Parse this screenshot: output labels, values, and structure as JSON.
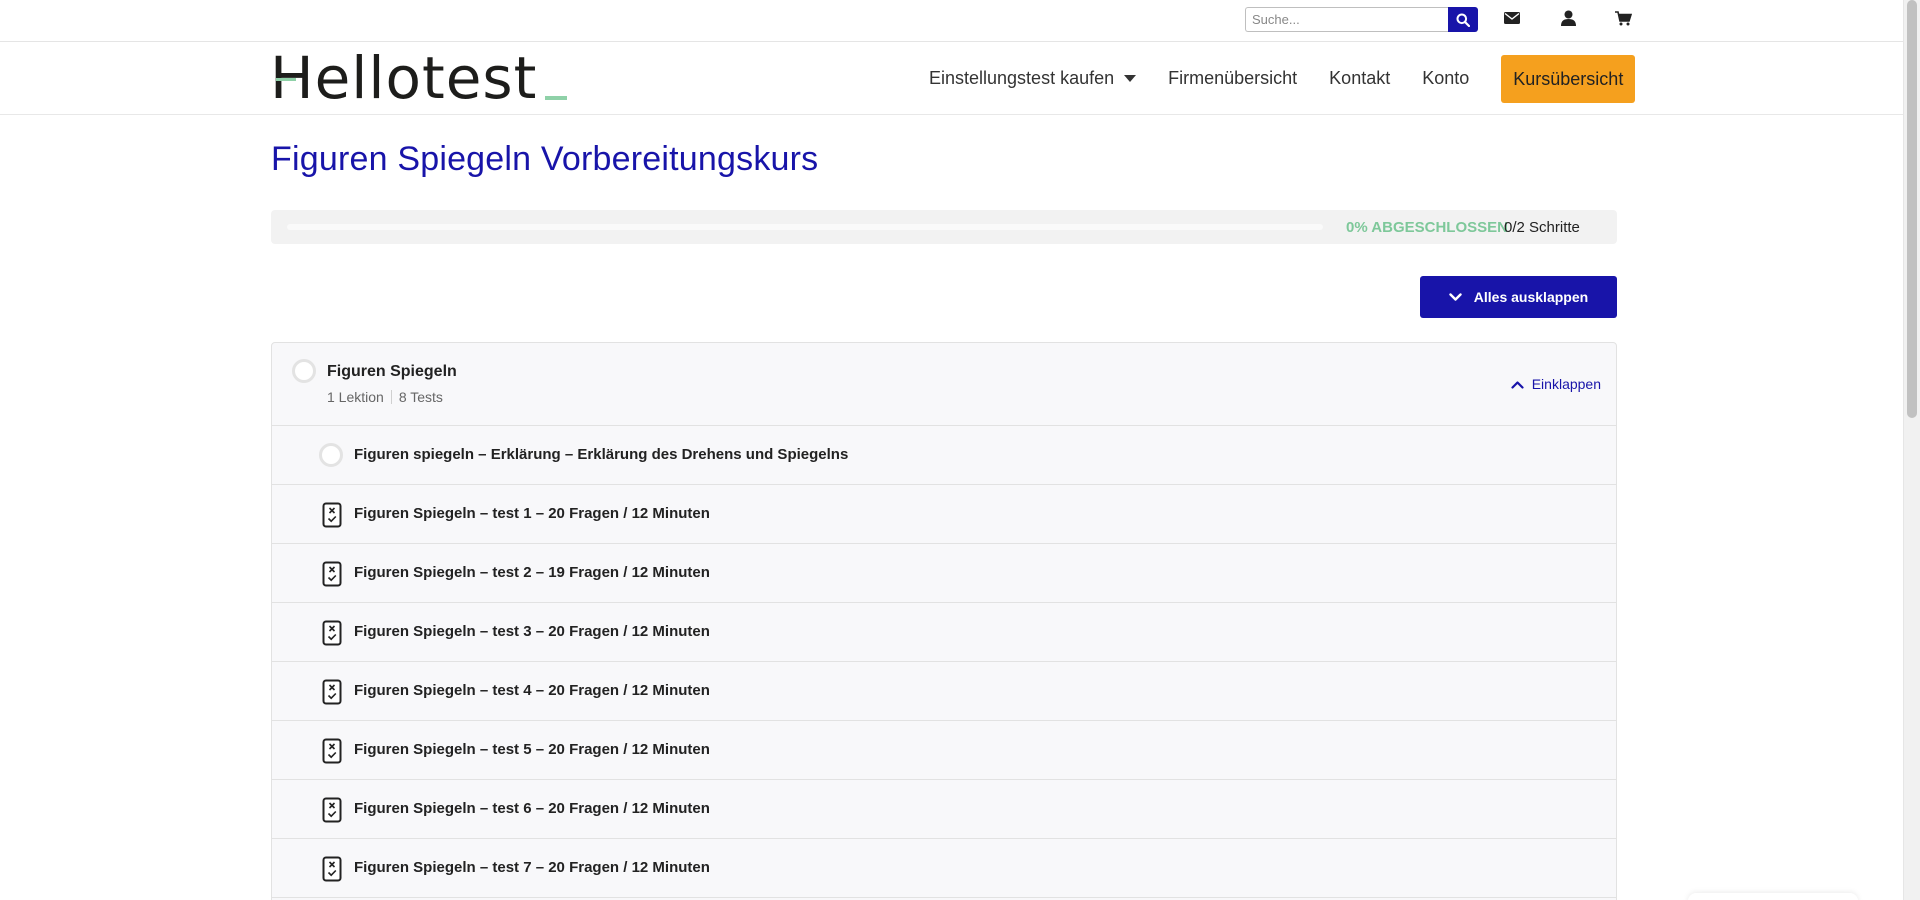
{
  "topbar": {
    "search_placeholder": "Suche...",
    "icons": [
      "search-icon",
      "envelope-icon",
      "user-icon",
      "cart-icon"
    ]
  },
  "header": {
    "logo_text": "Hellotest",
    "nav": [
      {
        "label": "Einstellungstest kaufen",
        "has_dropdown": true
      },
      {
        "label": "Firmenübersicht"
      },
      {
        "label": "Kontakt"
      },
      {
        "label": "Konto"
      }
    ],
    "cta_label": "Kursübersicht"
  },
  "course": {
    "title": "Figuren Spiegeln Vorbereitungskurs",
    "progress": {
      "percent": 0,
      "label": "0% ABGESCHLOSSEN",
      "steps": "0/2 Schritte"
    },
    "expand_all_label": "Alles ausklappen",
    "section": {
      "title": "Figuren Spiegeln",
      "lessons": "1 Lektion",
      "tests": "8 Tests",
      "collapse_label": "Einklappen"
    },
    "items": [
      {
        "type": "lesson",
        "label": "Figuren spiegeln – Erklärung – Erklärung des Drehens und Spiegelns"
      },
      {
        "type": "quiz",
        "label": "Figuren Spiegeln – test 1 – 20 Fragen / 12 Minuten"
      },
      {
        "type": "quiz",
        "label": "Figuren Spiegeln – test 2 – 19 Fragen / 12 Minuten"
      },
      {
        "type": "quiz",
        "label": "Figuren Spiegeln – test 3 – 20 Fragen / 12 Minuten"
      },
      {
        "type": "quiz",
        "label": "Figuren Spiegeln – test 4 – 20 Fragen / 12 Minuten"
      },
      {
        "type": "quiz",
        "label": "Figuren Spiegeln – test 5 – 20 Fragen / 12 Minuten"
      },
      {
        "type": "quiz",
        "label": "Figuren Spiegeln – test 6 – 20 Fragen / 12 Minuten"
      },
      {
        "type": "quiz",
        "label": "Figuren Spiegeln – test 7 – 20 Fragen / 12 Minuten"
      }
    ]
  },
  "colors": {
    "brand_blue": "#1814a9",
    "accent_orange": "#f5a01e",
    "progress_green": "#7ec89a"
  }
}
